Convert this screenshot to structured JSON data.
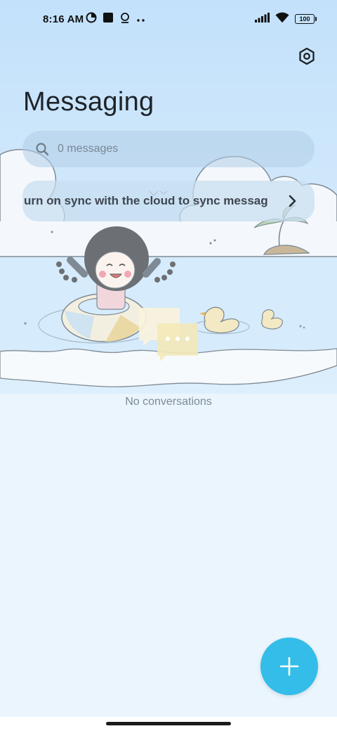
{
  "status_bar": {
    "time": "8:16 AM",
    "left_icons": [
      "data-saver-icon",
      "app-square-icon",
      "notification-icon",
      "more-dots-icon"
    ],
    "right_icons": [
      "signal-icon",
      "wifi-icon",
      "battery-icon"
    ],
    "battery_level": "100"
  },
  "header": {
    "title": "Messaging",
    "settings_icon": "settings-hexagon-icon"
  },
  "search": {
    "placeholder": "0 messages",
    "icon": "search-icon"
  },
  "sync_banner": {
    "text": "urn on sync with the cloud to sync messag",
    "icon": "chevron-right-icon"
  },
  "empty_state": {
    "text": "No conversations"
  },
  "fab": {
    "icon": "plus-icon"
  },
  "colors": {
    "background": "#eaf5fd",
    "header_background": "#c3e1fb",
    "fab": "#33bde8",
    "title": "#1e2328"
  }
}
